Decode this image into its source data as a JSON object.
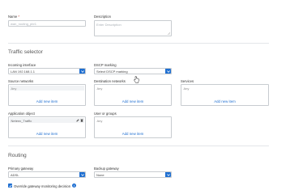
{
  "name": {
    "label": "Name",
    "required_mark": "*",
    "placeholder": "wan_routing_pbr1"
  },
  "description": {
    "label": "Description",
    "placeholder": "Enter Description"
  },
  "traffic_selector": {
    "title": "Traffic selector",
    "incoming_interface": {
      "label": "Incoming interface",
      "value": "LAN 192.168.1.1"
    },
    "dscp_marking": {
      "label": "DSCP marking",
      "value": "Select DSCP marking"
    },
    "source_networks": {
      "label": "Source networks",
      "value": "Any",
      "add_new": "Add new item"
    },
    "destination_networks": {
      "label": "Destination networks",
      "value": "Any",
      "add_new": "Add new item"
    },
    "services": {
      "label": "Services",
      "value": "Any",
      "add_new": "Add new item"
    },
    "application_object": {
      "label": "Application object",
      "value": "Netenv_Traffic",
      "add_new": "Add new item"
    },
    "user_or_groups": {
      "label": "User or groups",
      "value": "Any",
      "add_new": "Add new item"
    }
  },
  "routing": {
    "title": "Routing",
    "primary_gateway": {
      "label": "Primary gateway",
      "value": "ADSL"
    },
    "backup_gateway": {
      "label": "Backup gateway",
      "value": "None"
    },
    "override_checkbox": {
      "label": "Override gateway monitoring decision",
      "checked": true
    },
    "info_icon": "i"
  },
  "icons": {
    "dropdown": "chevron-down-icon",
    "edit": "pencil-icon",
    "delete": "trash-icon",
    "cursor": "pointer-cursor-icon"
  },
  "colors": {
    "accent": "#1f6fd1",
    "border": "#c8ccd0",
    "required": "#c0392b"
  }
}
